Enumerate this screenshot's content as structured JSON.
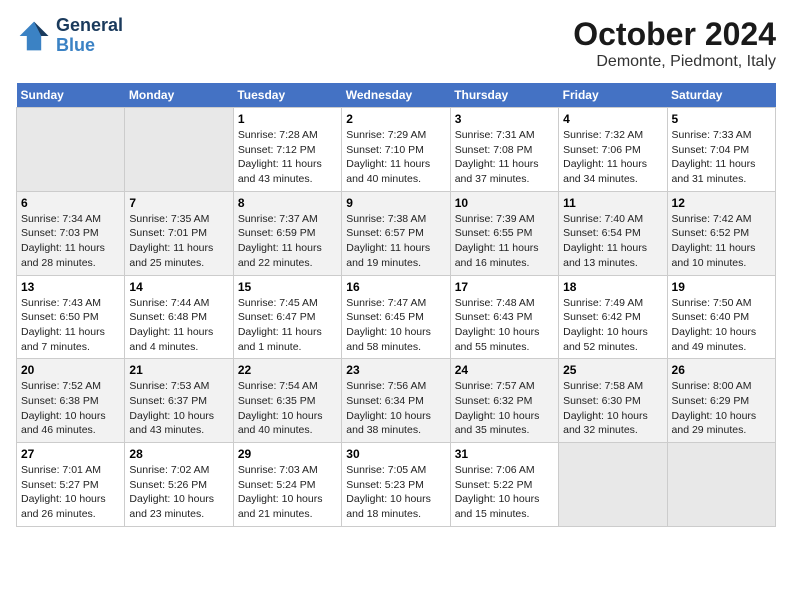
{
  "logo": {
    "line1": "General",
    "line2": "Blue"
  },
  "title": "October 2024",
  "subtitle": "Demonte, Piedmont, Italy",
  "days_of_week": [
    "Sunday",
    "Monday",
    "Tuesday",
    "Wednesday",
    "Thursday",
    "Friday",
    "Saturday"
  ],
  "weeks": [
    [
      {
        "day": "",
        "empty": true
      },
      {
        "day": "",
        "empty": true
      },
      {
        "day": "1",
        "sunrise": "Sunrise: 7:28 AM",
        "sunset": "Sunset: 7:12 PM",
        "daylight": "Daylight: 11 hours and 43 minutes."
      },
      {
        "day": "2",
        "sunrise": "Sunrise: 7:29 AM",
        "sunset": "Sunset: 7:10 PM",
        "daylight": "Daylight: 11 hours and 40 minutes."
      },
      {
        "day": "3",
        "sunrise": "Sunrise: 7:31 AM",
        "sunset": "Sunset: 7:08 PM",
        "daylight": "Daylight: 11 hours and 37 minutes."
      },
      {
        "day": "4",
        "sunrise": "Sunrise: 7:32 AM",
        "sunset": "Sunset: 7:06 PM",
        "daylight": "Daylight: 11 hours and 34 minutes."
      },
      {
        "day": "5",
        "sunrise": "Sunrise: 7:33 AM",
        "sunset": "Sunset: 7:04 PM",
        "daylight": "Daylight: 11 hours and 31 minutes."
      }
    ],
    [
      {
        "day": "6",
        "sunrise": "Sunrise: 7:34 AM",
        "sunset": "Sunset: 7:03 PM",
        "daylight": "Daylight: 11 hours and 28 minutes."
      },
      {
        "day": "7",
        "sunrise": "Sunrise: 7:35 AM",
        "sunset": "Sunset: 7:01 PM",
        "daylight": "Daylight: 11 hours and 25 minutes."
      },
      {
        "day": "8",
        "sunrise": "Sunrise: 7:37 AM",
        "sunset": "Sunset: 6:59 PM",
        "daylight": "Daylight: 11 hours and 22 minutes."
      },
      {
        "day": "9",
        "sunrise": "Sunrise: 7:38 AM",
        "sunset": "Sunset: 6:57 PM",
        "daylight": "Daylight: 11 hours and 19 minutes."
      },
      {
        "day": "10",
        "sunrise": "Sunrise: 7:39 AM",
        "sunset": "Sunset: 6:55 PM",
        "daylight": "Daylight: 11 hours and 16 minutes."
      },
      {
        "day": "11",
        "sunrise": "Sunrise: 7:40 AM",
        "sunset": "Sunset: 6:54 PM",
        "daylight": "Daylight: 11 hours and 13 minutes."
      },
      {
        "day": "12",
        "sunrise": "Sunrise: 7:42 AM",
        "sunset": "Sunset: 6:52 PM",
        "daylight": "Daylight: 11 hours and 10 minutes."
      }
    ],
    [
      {
        "day": "13",
        "sunrise": "Sunrise: 7:43 AM",
        "sunset": "Sunset: 6:50 PM",
        "daylight": "Daylight: 11 hours and 7 minutes."
      },
      {
        "day": "14",
        "sunrise": "Sunrise: 7:44 AM",
        "sunset": "Sunset: 6:48 PM",
        "daylight": "Daylight: 11 hours and 4 minutes."
      },
      {
        "day": "15",
        "sunrise": "Sunrise: 7:45 AM",
        "sunset": "Sunset: 6:47 PM",
        "daylight": "Daylight: 11 hours and 1 minute."
      },
      {
        "day": "16",
        "sunrise": "Sunrise: 7:47 AM",
        "sunset": "Sunset: 6:45 PM",
        "daylight": "Daylight: 10 hours and 58 minutes."
      },
      {
        "day": "17",
        "sunrise": "Sunrise: 7:48 AM",
        "sunset": "Sunset: 6:43 PM",
        "daylight": "Daylight: 10 hours and 55 minutes."
      },
      {
        "day": "18",
        "sunrise": "Sunrise: 7:49 AM",
        "sunset": "Sunset: 6:42 PM",
        "daylight": "Daylight: 10 hours and 52 minutes."
      },
      {
        "day": "19",
        "sunrise": "Sunrise: 7:50 AM",
        "sunset": "Sunset: 6:40 PM",
        "daylight": "Daylight: 10 hours and 49 minutes."
      }
    ],
    [
      {
        "day": "20",
        "sunrise": "Sunrise: 7:52 AM",
        "sunset": "Sunset: 6:38 PM",
        "daylight": "Daylight: 10 hours and 46 minutes."
      },
      {
        "day": "21",
        "sunrise": "Sunrise: 7:53 AM",
        "sunset": "Sunset: 6:37 PM",
        "daylight": "Daylight: 10 hours and 43 minutes."
      },
      {
        "day": "22",
        "sunrise": "Sunrise: 7:54 AM",
        "sunset": "Sunset: 6:35 PM",
        "daylight": "Daylight: 10 hours and 40 minutes."
      },
      {
        "day": "23",
        "sunrise": "Sunrise: 7:56 AM",
        "sunset": "Sunset: 6:34 PM",
        "daylight": "Daylight: 10 hours and 38 minutes."
      },
      {
        "day": "24",
        "sunrise": "Sunrise: 7:57 AM",
        "sunset": "Sunset: 6:32 PM",
        "daylight": "Daylight: 10 hours and 35 minutes."
      },
      {
        "day": "25",
        "sunrise": "Sunrise: 7:58 AM",
        "sunset": "Sunset: 6:30 PM",
        "daylight": "Daylight: 10 hours and 32 minutes."
      },
      {
        "day": "26",
        "sunrise": "Sunrise: 8:00 AM",
        "sunset": "Sunset: 6:29 PM",
        "daylight": "Daylight: 10 hours and 29 minutes."
      }
    ],
    [
      {
        "day": "27",
        "sunrise": "Sunrise: 7:01 AM",
        "sunset": "Sunset: 5:27 PM",
        "daylight": "Daylight: 10 hours and 26 minutes."
      },
      {
        "day": "28",
        "sunrise": "Sunrise: 7:02 AM",
        "sunset": "Sunset: 5:26 PM",
        "daylight": "Daylight: 10 hours and 23 minutes."
      },
      {
        "day": "29",
        "sunrise": "Sunrise: 7:03 AM",
        "sunset": "Sunset: 5:24 PM",
        "daylight": "Daylight: 10 hours and 21 minutes."
      },
      {
        "day": "30",
        "sunrise": "Sunrise: 7:05 AM",
        "sunset": "Sunset: 5:23 PM",
        "daylight": "Daylight: 10 hours and 18 minutes."
      },
      {
        "day": "31",
        "sunrise": "Sunrise: 7:06 AM",
        "sunset": "Sunset: 5:22 PM",
        "daylight": "Daylight: 10 hours and 15 minutes."
      },
      {
        "day": "",
        "empty": true
      },
      {
        "day": "",
        "empty": true
      }
    ]
  ]
}
